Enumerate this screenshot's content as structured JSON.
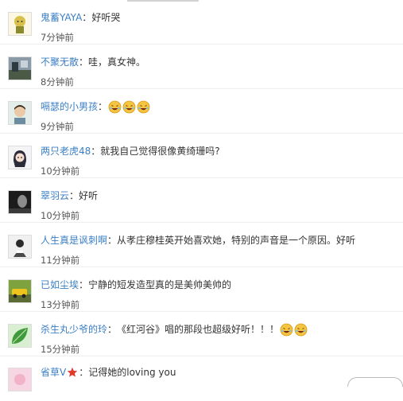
{
  "comments": [
    {
      "username": "鬼蓄YAYA",
      "text": "好听哭",
      "emoji_count": 0,
      "time": "7分钟前",
      "avatar_icon": "yellow-cartoon-avatar"
    },
    {
      "username": "不聚无散",
      "text": "哇，真女神。",
      "emoji_count": 0,
      "time": "8分钟前",
      "avatar_icon": "street-photo-avatar"
    },
    {
      "username": "嗝瑟的小男孩",
      "text": "",
      "emoji_count": 3,
      "time": "9分钟前",
      "avatar_icon": "boy-portrait-avatar"
    },
    {
      "username": "两只老虎48",
      "text": "就我自己觉得很像黄绮珊吗?",
      "emoji_count": 0,
      "time": "10分钟前",
      "avatar_icon": "anime-girl-avatar"
    },
    {
      "username": "翠羽云",
      "text": "好听",
      "emoji_count": 0,
      "time": "10分钟前",
      "avatar_icon": "monochrome-portrait-avatar"
    },
    {
      "username": "人生真是讽刺啊",
      "text": "从孝庄穆桂英开始喜欢她，特别的声音是一个原因。好听",
      "emoji_count": 0,
      "time": "11分钟前",
      "avatar_icon": "black-white-figure-avatar"
    },
    {
      "username": "已如尘埃",
      "text": "宁静的短发造型真的是美帅美帅的",
      "emoji_count": 0,
      "time": "13分钟前",
      "avatar_icon": "yellow-car-avatar"
    },
    {
      "username": "杀生丸少爷的玲",
      "text": "《红河谷》唱的那段也超级好听！！！",
      "emoji_count": 2,
      "time": "15分钟前",
      "avatar_icon": "green-leaf-avatar"
    },
    {
      "username": "省草V",
      "text": "记得她的loving you",
      "emoji_count": 0,
      "time": "",
      "avatar_icon": "pink-avatar",
      "vip_badge": "red-star-icon"
    }
  ],
  "colors": {
    "username": "#3b7fc4",
    "text": "#333333",
    "time": "#555555",
    "divider": "#eeeeee",
    "vip_star": "#e23b2e",
    "emoji": "#f5c542"
  }
}
